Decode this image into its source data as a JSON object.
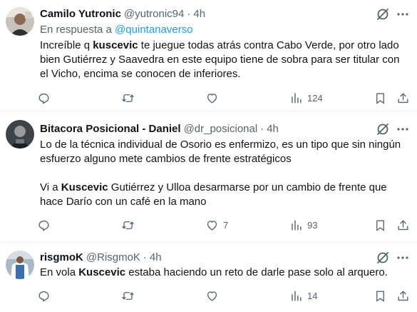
{
  "tweets": [
    {
      "author": "Camilo Yutronic",
      "handle": "@yutronic94",
      "sep": "·",
      "time": "4h",
      "reply_prefix": "En respuesta a",
      "reply_mention": "@quintanaverso",
      "lines": [
        [
          "Increíble q ",
          "kuscevic",
          " te juegue todas atrás contra Cabo Verde, por otro lado"
        ],
        [
          "bien Gutiérrez y Saavedra en este equipo tiene de sobra para ser titular con",
          "",
          ""
        ],
        [
          "el Vicho, encima se conocen de inferiores.",
          "",
          ""
        ]
      ],
      "stats": {
        "replies": "",
        "reposts": "",
        "likes": "",
        "views": "124"
      }
    },
    {
      "author": "Bitacora Posicional - Daniel",
      "handle": "@dr_posicional",
      "sep": "·",
      "time": "4h",
      "lines": [
        [
          "Lo de la técnica individual de Osorio es enfermizo, es un tipo que sin ningún",
          "",
          ""
        ],
        [
          "esfuerzo alguno mete cambios de frente estratégicos",
          "",
          ""
        ],
        [
          "",
          "",
          ""
        ],
        [
          "Vi a ",
          "Kuscevic",
          " Gutiérrez y Ulloa desarmarse por un cambio de frente que"
        ],
        [
          "hace Darío con un café en la mano",
          "",
          ""
        ]
      ],
      "stats": {
        "replies": "",
        "reposts": "",
        "likes": "7",
        "views": "93"
      }
    },
    {
      "author": "risgmoK",
      "handle": "@RisgmoK",
      "sep": "·",
      "time": "4h",
      "lines": [
        [
          "En vola ",
          "Kuscevic",
          " estaba haciendo un reto de darle pase solo al arquero."
        ]
      ],
      "stats": {
        "replies": "",
        "reposts": "",
        "likes": "",
        "views": "14"
      }
    }
  ],
  "icons": {
    "grok": "grok-icon",
    "more": "more-icon",
    "reply": "reply-icon",
    "repost": "repost-icon",
    "like": "like-icon",
    "views": "views-icon",
    "bookmark": "bookmark-icon",
    "share": "share-icon"
  },
  "colors": {
    "text": "#0f1419",
    "secondary": "#536471",
    "link": "#1d9bf0",
    "divider": "#eff3f4"
  }
}
